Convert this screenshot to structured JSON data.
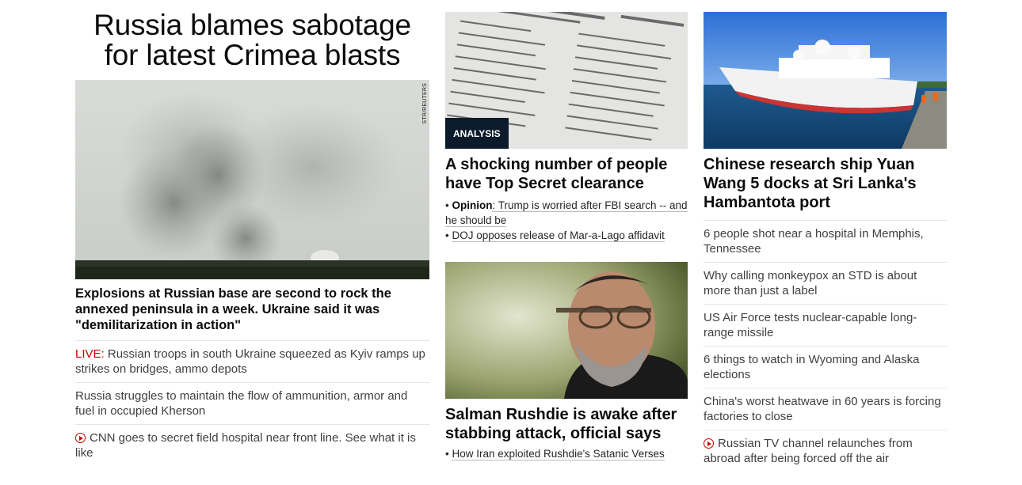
{
  "hero": {
    "title": "Russia blames sabotage for latest Crimea blasts",
    "image_credit": "STR/REUTERS",
    "lead": "Explosions at Russian base are second to rock the annexed peninsula in a week. Ukraine said it was \"demilitarization in action\"",
    "links": [
      {
        "prefix": "LIVE:",
        "text": " Russian troops in south Ukraine squeezed as Kyiv ramps up strikes on bridges, ammo depots"
      },
      {
        "prefix": "",
        "text": "Russia struggles to maintain the flow of ammunition, armor and fuel in occupied Kherson"
      },
      {
        "prefix": "",
        "text": "CNN goes to secret field hospital near front line. See what it is like",
        "icon": "play-icon"
      }
    ]
  },
  "middle": {
    "story1": {
      "badge": "ANALYSIS",
      "headline": "A shocking number of people have Top Secret clearance",
      "sub1_bold": "Opinion",
      "sub1_text": ": Trump is worried after FBI search -- and he should be",
      "sub2": "DOJ opposes release of Mar-a-Lago affidavit"
    },
    "story2": {
      "headline": "Salman Rushdie is awake after stabbing attack, official says",
      "sub1": "How Iran exploited Rushdie's Satanic Verses"
    }
  },
  "right": {
    "headline": "Chinese research ship Yuan Wang 5 docks at Sri Lanka's Hambantota port",
    "items": [
      "6 people shot near a hospital in Memphis, Tennessee",
      "Why calling monkeypox an STD is about more than just a label",
      "US Air Force tests nuclear-capable long-range missile",
      "6 things to watch in Wyoming and Alaska elections",
      "China's worst heatwave in 60 years is forcing factories to close",
      "Russian TV channel relaunches from abroad after being forced off the air"
    ]
  },
  "colors": {
    "accent_live": "#cc0000",
    "badge_bg": "#0c1b2b"
  }
}
